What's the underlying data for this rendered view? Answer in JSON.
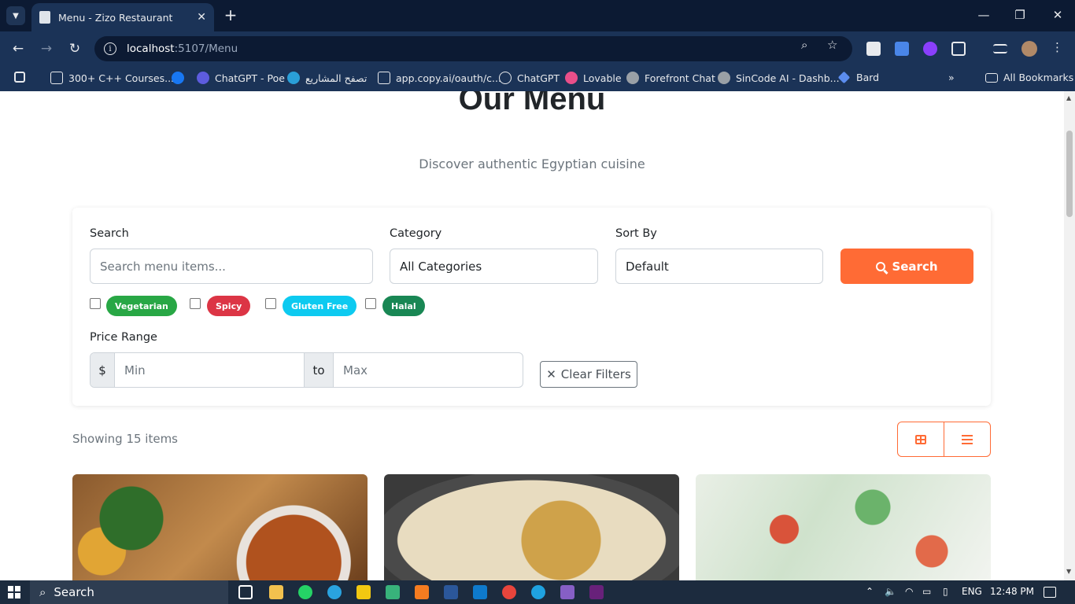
{
  "browser": {
    "tab_title": "Menu - Zizo Restaurant",
    "url_host": "localhost",
    "url_path": ":5107/Menu",
    "bookmarks": [
      "300+ C++ Courses...",
      "ChatGPT - Poe",
      "تصفح المشاريع",
      "app.copy.ai/oauth/c...",
      "ChatGPT",
      "Lovable",
      "Forefront Chat",
      "SinCode AI - Dashb...",
      "Bard"
    ],
    "all_bookmarks": "All Bookmarks"
  },
  "hero": {
    "title": "Our Menu",
    "subtitle": "Discover authentic Egyptian cuisine"
  },
  "filters": {
    "search_label": "Search",
    "search_placeholder": "Search menu items...",
    "category_label": "Category",
    "category_value": "All Categories",
    "sort_label": "Sort By",
    "sort_value": "Default",
    "search_button": "Search",
    "tags": [
      {
        "label": "Vegetarian",
        "color": "#28a745"
      },
      {
        "label": "Spicy",
        "color": "#dc3545"
      },
      {
        "label": "Gluten Free",
        "color": "#0dcaf0"
      },
      {
        "label": "Halal",
        "color": "#198754"
      }
    ],
    "price_label": "Price Range",
    "currency": "$",
    "min_placeholder": "Min",
    "to_label": "to",
    "max_placeholder": "Max",
    "clear_button": "Clear Filters"
  },
  "results": {
    "count_text": "Showing 15 items"
  },
  "colors": {
    "accent": "#ff6b35"
  },
  "taskbar": {
    "search_text": "Search",
    "lang": "ENG",
    "time": "12:48 PM"
  }
}
